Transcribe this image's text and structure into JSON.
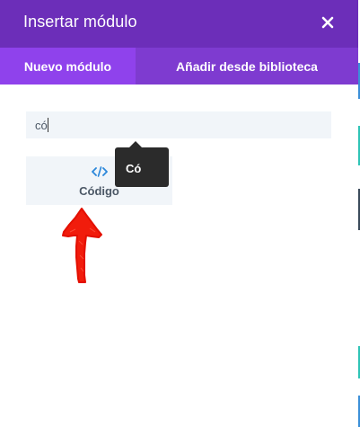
{
  "modal": {
    "title": "Insertar módulo",
    "close_icon": "close-icon"
  },
  "tabs": [
    {
      "label": "Nuevo módulo",
      "active": true
    },
    {
      "label": "Añadir desde biblioteca",
      "active": false
    }
  ],
  "search": {
    "value": "có",
    "placeholder": ""
  },
  "tooltip": {
    "text": "Có"
  },
  "modules": [
    {
      "label": "Código",
      "icon": "code-icon"
    }
  ],
  "annotation": {
    "icon": "red-arrow-up"
  },
  "colors": {
    "header": "#6c2eb9",
    "tabs_bar": "#7e3bd0",
    "active_tab": "#8f42ec",
    "input_bg": "#f1f5f9",
    "module_icon": "#2b87da",
    "tooltip_bg": "#2b2b2b",
    "annotation": "#ff0000"
  }
}
